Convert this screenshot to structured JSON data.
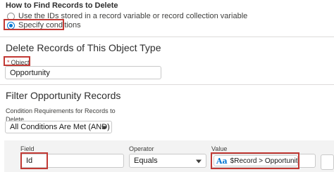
{
  "find_records": {
    "heading": "How to Find Records to Delete",
    "options": [
      {
        "label": "Use the IDs stored in a record variable or record collection variable",
        "selected": false
      },
      {
        "label": "Specify conditions",
        "selected": true
      }
    ]
  },
  "delete_section": {
    "title": "Delete Records of This Object Type",
    "object_label": "Object",
    "required_marker": "*",
    "object_value": "Opportunity"
  },
  "filter_section": {
    "title": "Filter Opportunity Records",
    "condition_label": "Condition Requirements for Records to Delete",
    "condition_value": "All Conditions Are Met (AND)",
    "row": {
      "field_label": "Field",
      "field_value": "Id",
      "operator_label": "Operator",
      "operator_value": "Equals",
      "value_label": "Value",
      "value_text": "$Record > Opportunity ID",
      "value_icon": "Aa",
      "clear_glyph": "✕"
    }
  },
  "colors": {
    "accent": "#0176d3",
    "highlight": "#c23934",
    "border": "#c9c9c9"
  }
}
